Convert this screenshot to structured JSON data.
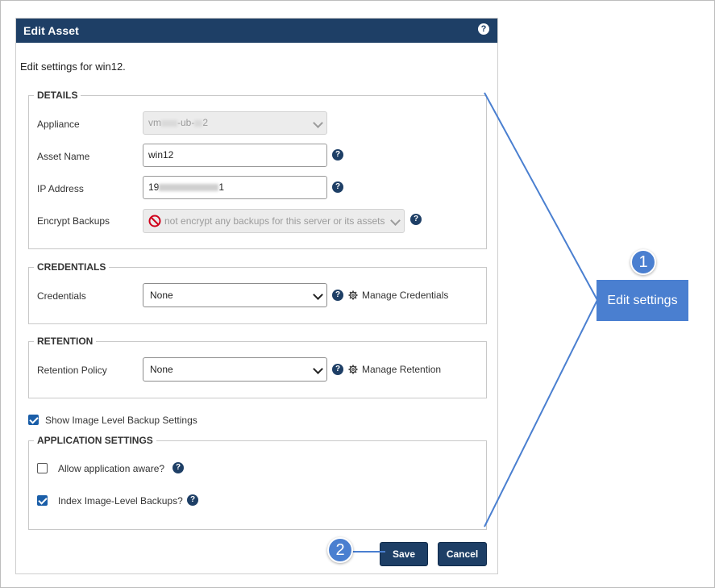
{
  "dialog": {
    "title": "Edit Asset",
    "help_glyph": "?",
    "intro": "Edit settings for win12."
  },
  "details": {
    "legend": "DETAILS",
    "appliance": {
      "label": "Appliance",
      "value_prefix": "vm",
      "value_mid": "-ub-",
      "value_suffix": "2"
    },
    "asset_name": {
      "label": "Asset Name",
      "value": "win12"
    },
    "ip_address": {
      "label": "IP Address",
      "value_prefix": "19",
      "value_suffix": "1"
    },
    "encrypt": {
      "label": "Encrypt Backups",
      "value": "not encrypt any backups for this server or its assets"
    }
  },
  "credentials": {
    "legend": "CREDENTIALS",
    "label": "Credentials",
    "value": "None",
    "manage": "Manage Credentials"
  },
  "retention": {
    "legend": "RETENTION",
    "label": "Retention Policy",
    "value": "None",
    "manage": "Manage Retention"
  },
  "show_image_level": {
    "label": "Show Image Level Backup Settings",
    "checked": true
  },
  "application_settings": {
    "legend": "APPLICATION SETTINGS",
    "allow_app_aware": {
      "label": "Allow application aware?",
      "checked": false
    },
    "index_image_level": {
      "label": "Index Image-Level Backups?",
      "checked": true
    }
  },
  "buttons": {
    "save": "Save",
    "cancel": "Cancel"
  },
  "callouts": {
    "badge1": "1",
    "badge2": "2",
    "edit_settings": "Edit settings",
    "color": "#4a7fd0"
  },
  "colors": {
    "header": "#1e3f66",
    "checkbox": "#1a5ea8",
    "disabled_icon": "#d0021b"
  }
}
